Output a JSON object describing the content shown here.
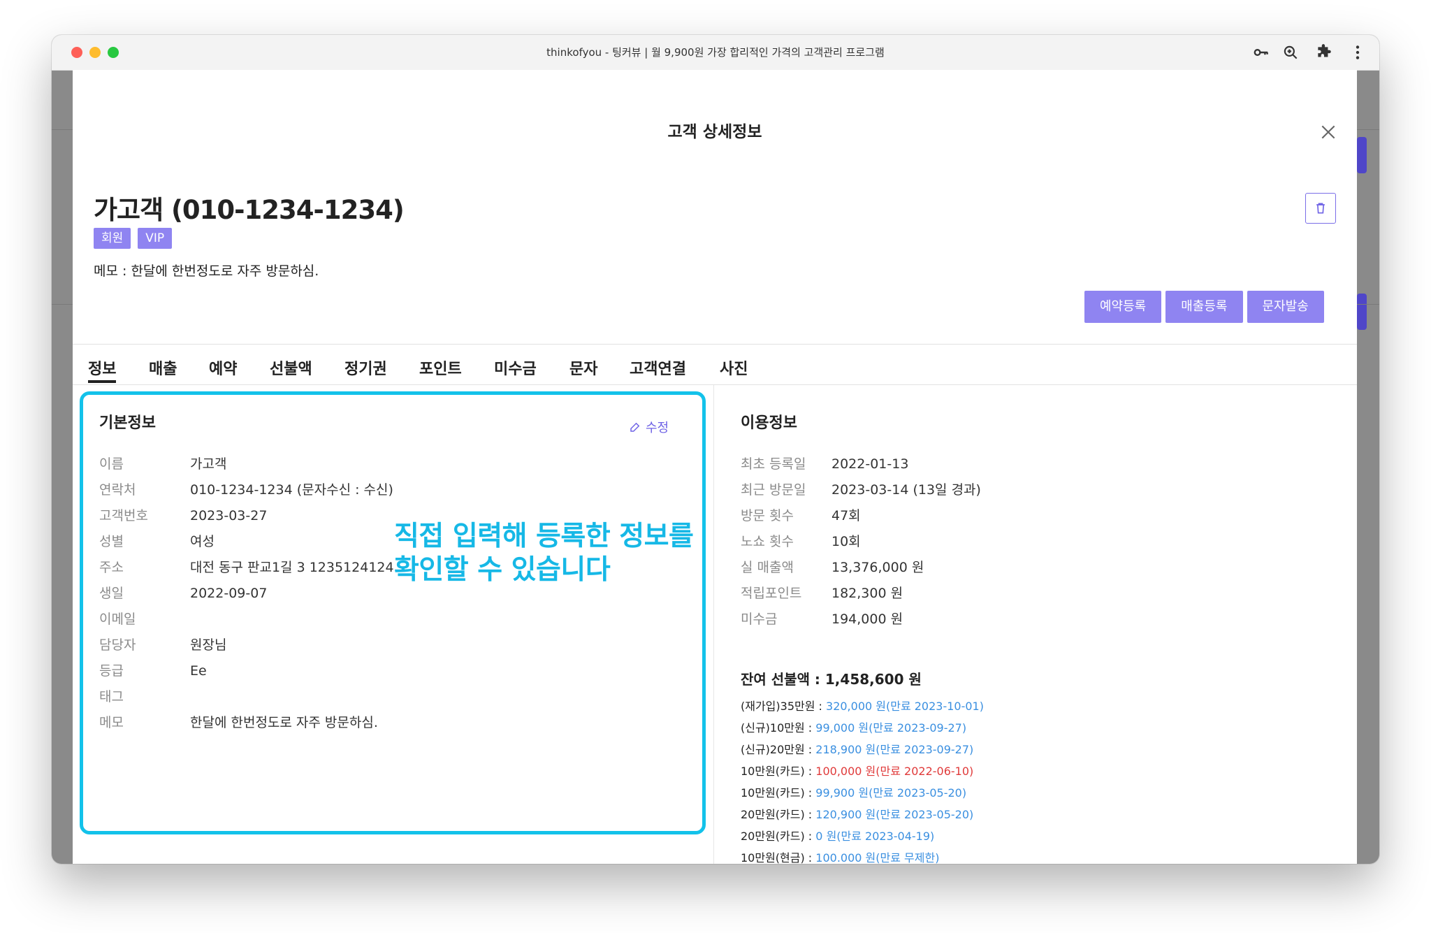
{
  "window": {
    "title": "thinkofyou - 팅커뷰 | 월 9,900원 가장 합리적인 가격의 고객관리 프로그램",
    "toolbar_icons": [
      "key-icon",
      "zoom-icon",
      "extension-icon",
      "more-icon"
    ]
  },
  "modal": {
    "title": "고객 상세정보"
  },
  "customer": {
    "name": "가고객 (010-1234-1234)",
    "badges": [
      "회원",
      "VIP"
    ],
    "memo": "메모 : 한달에 한번정도로 자주 방문하심."
  },
  "actions": [
    "예약등록",
    "매출등록",
    "문자발송"
  ],
  "tabs": [
    "정보",
    "매출",
    "예약",
    "선불액",
    "정기권",
    "포인트",
    "미수금",
    "문자",
    "고객연결",
    "사진"
  ],
  "active_tab": "정보",
  "basic_info": {
    "title": "기본정보",
    "edit_label": "수정",
    "fields": [
      {
        "label": "이름",
        "value": "가고객"
      },
      {
        "label": "연락처",
        "value": "010-1234-1234 (문자수신 : 수신)"
      },
      {
        "label": "고객번호",
        "value": "2023-03-27"
      },
      {
        "label": "성별",
        "value": "여성"
      },
      {
        "label": "주소",
        "value": "대전 동구 판교1길 3 1235124124"
      },
      {
        "label": "생일",
        "value": "2022-09-07"
      },
      {
        "label": "이메일",
        "value": ""
      },
      {
        "label": "담당자",
        "value": "원장님"
      },
      {
        "label": "등급",
        "value": "Ee"
      },
      {
        "label": "태그",
        "value": ""
      },
      {
        "label": "메모",
        "value": "한달에 한번정도로 자주 방문하심."
      }
    ]
  },
  "annotation": {
    "line1": "직접 입력해 등록한 정보를",
    "line2": "확인할 수 있습니다",
    "color": "#16b8e6"
  },
  "usage_info": {
    "title": "이용정보",
    "fields": [
      {
        "label": "최초 등록일",
        "value": "2022-01-13"
      },
      {
        "label": "최근 방문일",
        "value": "2023-03-14 (13일 경과)"
      },
      {
        "label": "방문 횟수",
        "value": "47회"
      },
      {
        "label": "노쇼 횟수",
        "value": "10회"
      },
      {
        "label": "실 매출액",
        "value": "13,376,000 원"
      },
      {
        "label": "적립포인트",
        "value": "182,300 원"
      },
      {
        "label": "미수금",
        "value": "194,000 원"
      }
    ]
  },
  "prepaid": {
    "title": "잔여 선불액 : 1,458,600 원",
    "items": [
      {
        "name": "(재가입)35만원 : ",
        "value": "320,000 원(만료 2023-10-01)",
        "expired": false
      },
      {
        "name": "(신규)10만원 : ",
        "value": "99,000 원(만료 2023-09-27)",
        "expired": false
      },
      {
        "name": "(신규)20만원 : ",
        "value": "218,900 원(만료 2023-09-27)",
        "expired": false
      },
      {
        "name": "10만원(카드) : ",
        "value": "100,000 원(만료 2022-06-10)",
        "expired": true
      },
      {
        "name": "10만원(카드) : ",
        "value": "99,900 원(만료 2023-05-20)",
        "expired": false
      },
      {
        "name": "20만원(카드) : ",
        "value": "120,900 원(만료 2023-05-20)",
        "expired": false
      },
      {
        "name": "20만원(카드) : ",
        "value": "0 원(만료 2023-04-19)",
        "expired": false
      },
      {
        "name": "10만원(현금) : ",
        "value": "100.000 원(만료 무제한)",
        "expired": false
      }
    ]
  },
  "colors": {
    "accent": "#8f84f1",
    "highlight_border": "#13c2ea",
    "value_blue": "#3a8fe0",
    "expired_red": "#e03a3a"
  }
}
